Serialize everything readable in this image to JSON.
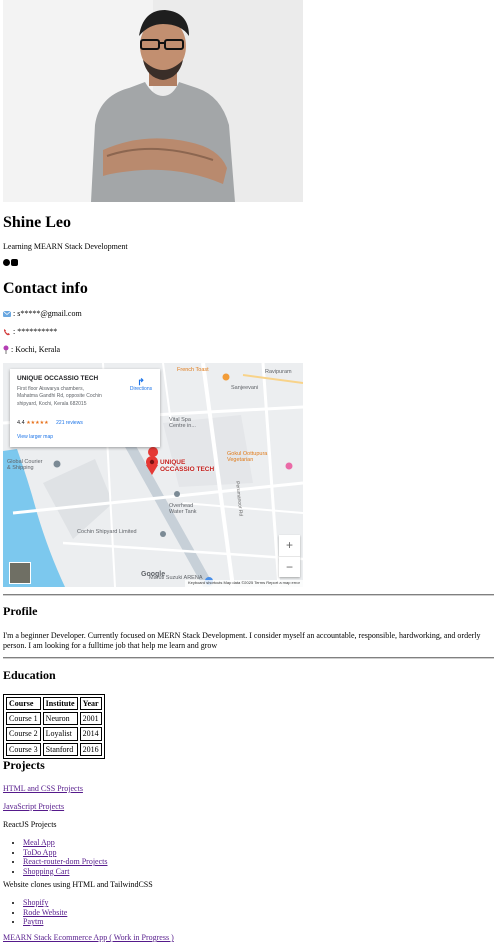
{
  "profile": {
    "name": "Shine Leo",
    "tagline": "Learning MEARN Stack Development",
    "social": [
      "github-icon",
      "linkedin-icon"
    ]
  },
  "contact": {
    "title": "Contact info",
    "email": ": s*****@gmail.com",
    "phone": ": **********",
    "location": ": Kochi, Kerala"
  },
  "map": {
    "place_title": "UNIQUE OCCASSIO TECH",
    "address": "First floor Aiswarya chambers, Mahatma Gandhi Rd, opposite Cochin shipyard, Kochi, Kerala 682015",
    "rating": "4.4",
    "stars": "★★★★★",
    "reviews": "221 reviews",
    "view_larger": "View larger map",
    "directions": "Directions",
    "pin_label_1": "UNIQUE",
    "pin_label_2": "OCCASSIO TECH",
    "zoom_in": "+",
    "zoom_out": "−",
    "google": "Google",
    "footer": "Keyboard shortcuts   Map data ©2025   Terms   Report a map error",
    "places": {
      "french_toast": "French Toast",
      "ravipuram": "Ravipuram",
      "sanjeevani": "Sanjeevani",
      "vital_spa_1": "Vital Spa",
      "vital_spa_2": "Centre in...",
      "gokul_1": "Gokul Oottupura",
      "gokul_2": "Vegetarian",
      "courier_1": "Global Courier",
      "courier_2": "& Shipping",
      "overhead_1": "Overhead",
      "overhead_2": "Water Tank",
      "cochin_shipyard": "Cochin Shipyard Limited",
      "arena": "Maruti Suzuki ARENA",
      "road": "Perumanoor Rd"
    }
  },
  "sections": {
    "profile_title": "Profile",
    "profile_text": "I'm a beginner Developer. Currently focused on MERN Stack Development. I consider myself an accountable, responsible, hardworking, and orderly person. I am looking for a fulltime job that help me learn and grow",
    "education_title": "Education",
    "projects_title": "Projects"
  },
  "education": {
    "headers": [
      "Course",
      "Institute",
      "Year"
    ],
    "rows": [
      [
        "Course 1",
        "Neuron",
        "2001"
      ],
      [
        "Course 2",
        "Loyalist",
        "2014"
      ],
      [
        "Course 3",
        "Stanford",
        "2016"
      ]
    ]
  },
  "projects": {
    "html_css": "HTML and CSS Projects",
    "javascript": "JavaScript Projects",
    "react_heading": "ReactJS Projects",
    "react_items": [
      "Meal App",
      "ToDo App",
      "React-router-dom Projects",
      "Shopping Cart"
    ],
    "clones_heading": "Website clones using HTML and TailwindCSS",
    "clone_items": [
      "Shopify",
      "Rode Website",
      "Paytm"
    ],
    "mearn": "MEARN Stack Ecommerce App ( Work in Progress )"
  }
}
